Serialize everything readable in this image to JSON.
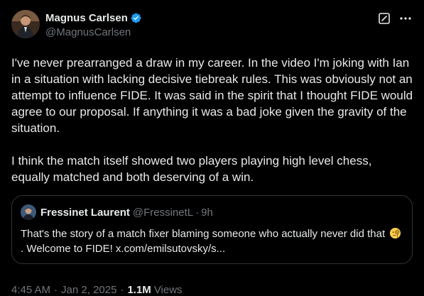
{
  "author": {
    "name": "Magnus Carlsen",
    "handle": "@MagnusCarlsen",
    "verified_color": "#1d9bf0"
  },
  "icons": {
    "verified": "verified-badge-icon",
    "grok": "grok-icon",
    "more": "more-options-icon"
  },
  "tweet": {
    "paragraph1": "I've never prearranged a draw in my career. In the video I'm joking with Ian in a situation with lacking decisive tiebreak rules. This was obviously not an attempt to influence FIDE. It was said in the spirit that I thought FIDE would agree to our proposal. If anything it was a bad joke given the gravity of the situation.",
    "paragraph2": "I think the match itself showed two players playing high level chess, equally matched and both deserving of a win."
  },
  "quote": {
    "name": "Fressinet Laurent",
    "handle": "@FressinetL",
    "dot": "·",
    "time": "9h",
    "text_before_emoji": "That's the story of a match fixer blaming someone who actually never did that",
    "emoji": "face-with-monocle-emoji",
    "text_after_emoji": ". Welcome to FIDE! x.com/emilsutovsky/s..."
  },
  "meta": {
    "time": "4:45 AM",
    "sep1": "·",
    "date": "Jan 2, 2025",
    "sep2": "·",
    "views_count": "1.1M",
    "views_label": "Views"
  },
  "colors": {
    "background": "#000000",
    "text": "#e7e9ea",
    "muted": "#71767b",
    "border": "#2f3336",
    "accent": "#1d9bf0"
  }
}
